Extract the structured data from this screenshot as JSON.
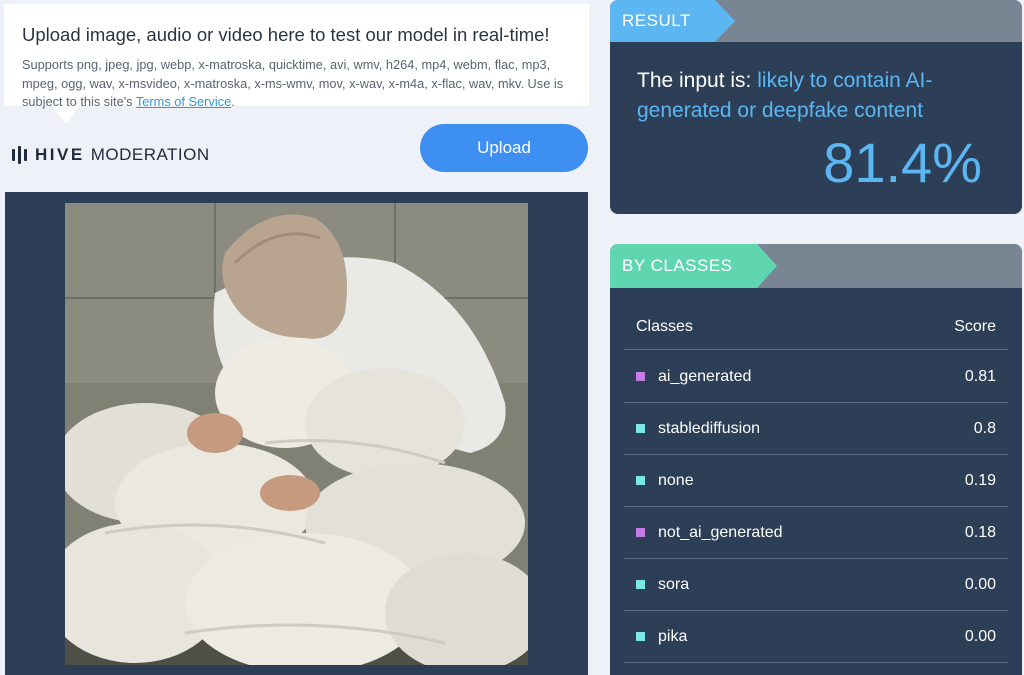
{
  "info": {
    "title": "Upload image, audio or video here to test our model in real-time!",
    "formats": "Supports png, jpeg, jpg, webp, x-matroska, quicktime, avi, wmv, h264, mp4, webm, flac, mp3, mpeg, ogg, wav, x-msvideo, x-matroska, x-ms-wmv, mov, x-wav, x-m4a, x-flac, wav, mkv. Use is subject to this site's",
    "terms_link": "Terms of Service",
    "terms_suffix": "."
  },
  "brand": {
    "hive": "HIVE",
    "moderation": "MODERATION"
  },
  "upload_button": "Upload",
  "result": {
    "tab": "RESULT",
    "prefix": "The input is: ",
    "verdict": "likely to contain AI-generated or deepfake content",
    "percent": "81.4%"
  },
  "classes": {
    "tab": "BY CLASSES",
    "col_class": "Classes",
    "col_score": "Score",
    "rows": [
      {
        "name": "ai_generated",
        "score": "0.81",
        "color": "#c879e8"
      },
      {
        "name": "stablediffusion",
        "score": "0.8",
        "color": "#7de8e8"
      },
      {
        "name": "none",
        "score": "0.19",
        "color": "#7de8e8"
      },
      {
        "name": "not_ai_generated",
        "score": "0.18",
        "color": "#c879e8"
      },
      {
        "name": "sora",
        "score": "0.00",
        "color": "#7de8e8"
      },
      {
        "name": "pika",
        "score": "0.00",
        "color": "#7de8e8"
      }
    ]
  },
  "colors": {
    "accent_blue": "#5bb6f2",
    "accent_green": "#5fd6b0",
    "upload_button": "#3d8ff2",
    "card_bg": "#2c3f57"
  }
}
